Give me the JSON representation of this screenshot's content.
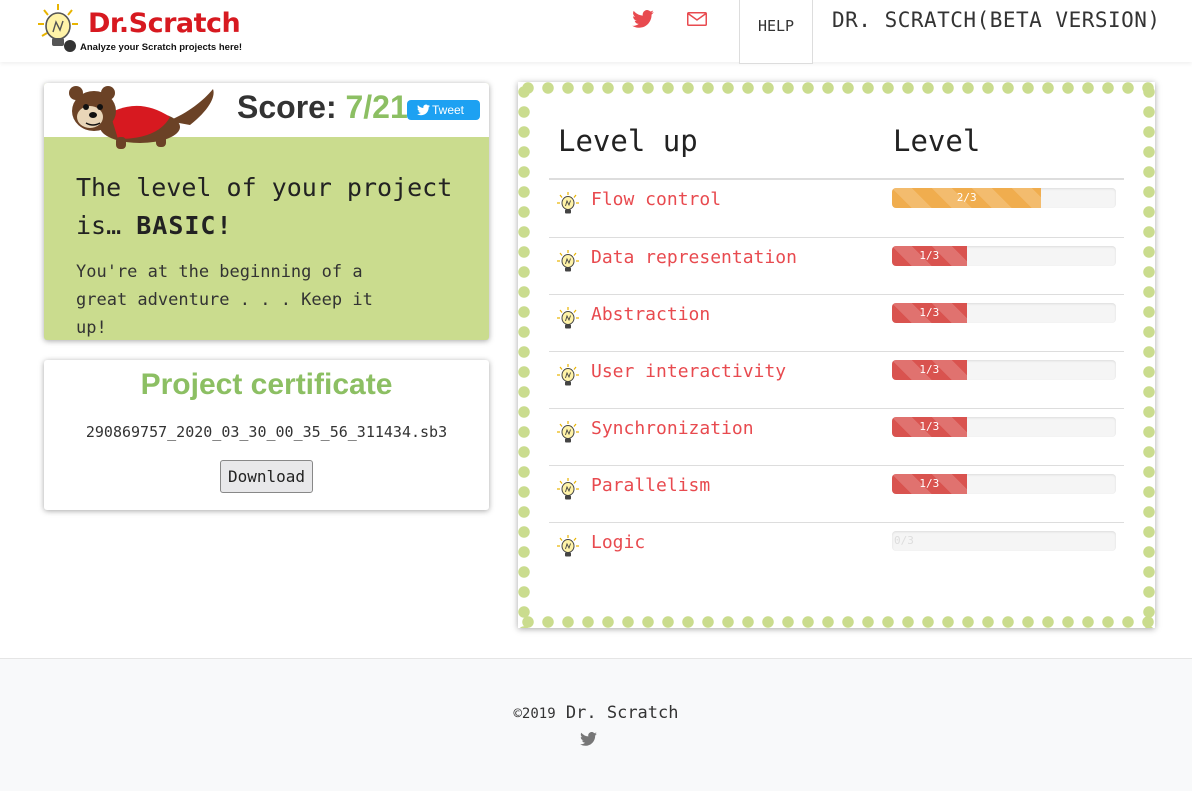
{
  "header": {
    "logo_title": "Dr.Scratch",
    "logo_tagline": "Analyze your Scratch projects here!",
    "nav_help": "HELP",
    "nav_brand": "DR. SCRATCH(BETA VERSION)",
    "icons": [
      "twitter-icon",
      "mail-icon"
    ]
  },
  "score": {
    "label": "Score:",
    "value": "7/21",
    "tweet_label": "Tweet",
    "level_prefix": "The level of your project is…",
    "level_word": "BASIC!",
    "message": "You're at the beginning of a great adventure . . . Keep it up!"
  },
  "certificate": {
    "title": "Project certificate",
    "filename": "290869757_2020_03_30_00_35_56_311434.sb3",
    "download_label": "Download"
  },
  "levels": {
    "header_skill": "Level up",
    "header_level": "Level",
    "rows": [
      {
        "label": "Flow control",
        "score": "2/3",
        "value": 2,
        "max": 3,
        "color": "#f0ad4e"
      },
      {
        "label": "Data representation",
        "score": "1/3",
        "value": 1,
        "max": 3,
        "color": "#d9534f"
      },
      {
        "label": "Abstraction",
        "score": "1/3",
        "value": 1,
        "max": 3,
        "color": "#d9534f"
      },
      {
        "label": "User interactivity",
        "score": "1/3",
        "value": 1,
        "max": 3,
        "color": "#d9534f"
      },
      {
        "label": "Synchronization",
        "score": "1/3",
        "value": 1,
        "max": 3,
        "color": "#d9534f"
      },
      {
        "label": "Parallelism",
        "score": "1/3",
        "value": 1,
        "max": 3,
        "color": "#d9534f"
      },
      {
        "label": "Logic",
        "score": "0/3",
        "value": 0,
        "max": 3,
        "color": "#d9534f"
      }
    ]
  },
  "footer": {
    "copyright": "©2019",
    "brand": "Dr. Scratch"
  },
  "colors": {
    "accent_green": "#8cbf63",
    "panel_green": "#cadc8e",
    "skill_red": "#e84a4f"
  }
}
